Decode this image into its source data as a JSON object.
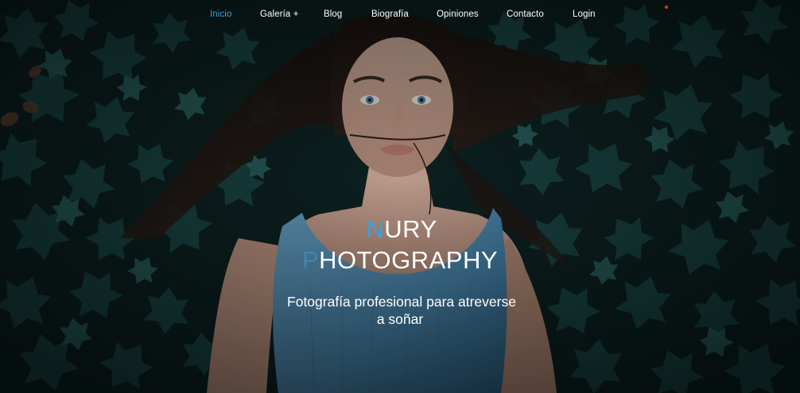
{
  "nav": {
    "items": [
      {
        "label": "Inicio",
        "active": true
      },
      {
        "label": "Galería +",
        "active": false
      },
      {
        "label": "Blog",
        "active": false
      },
      {
        "label": "Biografía",
        "active": false
      },
      {
        "label": "Opiniones",
        "active": false
      },
      {
        "label": "Contacto",
        "active": false
      },
      {
        "label": "Login",
        "active": false
      }
    ]
  },
  "hero": {
    "title_line1_initial": "N",
    "title_line1_rest": "URY",
    "title_line2_initial": "P",
    "title_line2_rest": "HOTOGRAPHY",
    "tagline_line1": "Fotografía profesional para atreverse",
    "tagline_line2": "a soñar"
  },
  "colors": {
    "accent": "#3da1db",
    "notification": "#e0342b",
    "background": "#0d1c1c",
    "ivy": "#1f5552",
    "dress": "#4d8fb6"
  }
}
